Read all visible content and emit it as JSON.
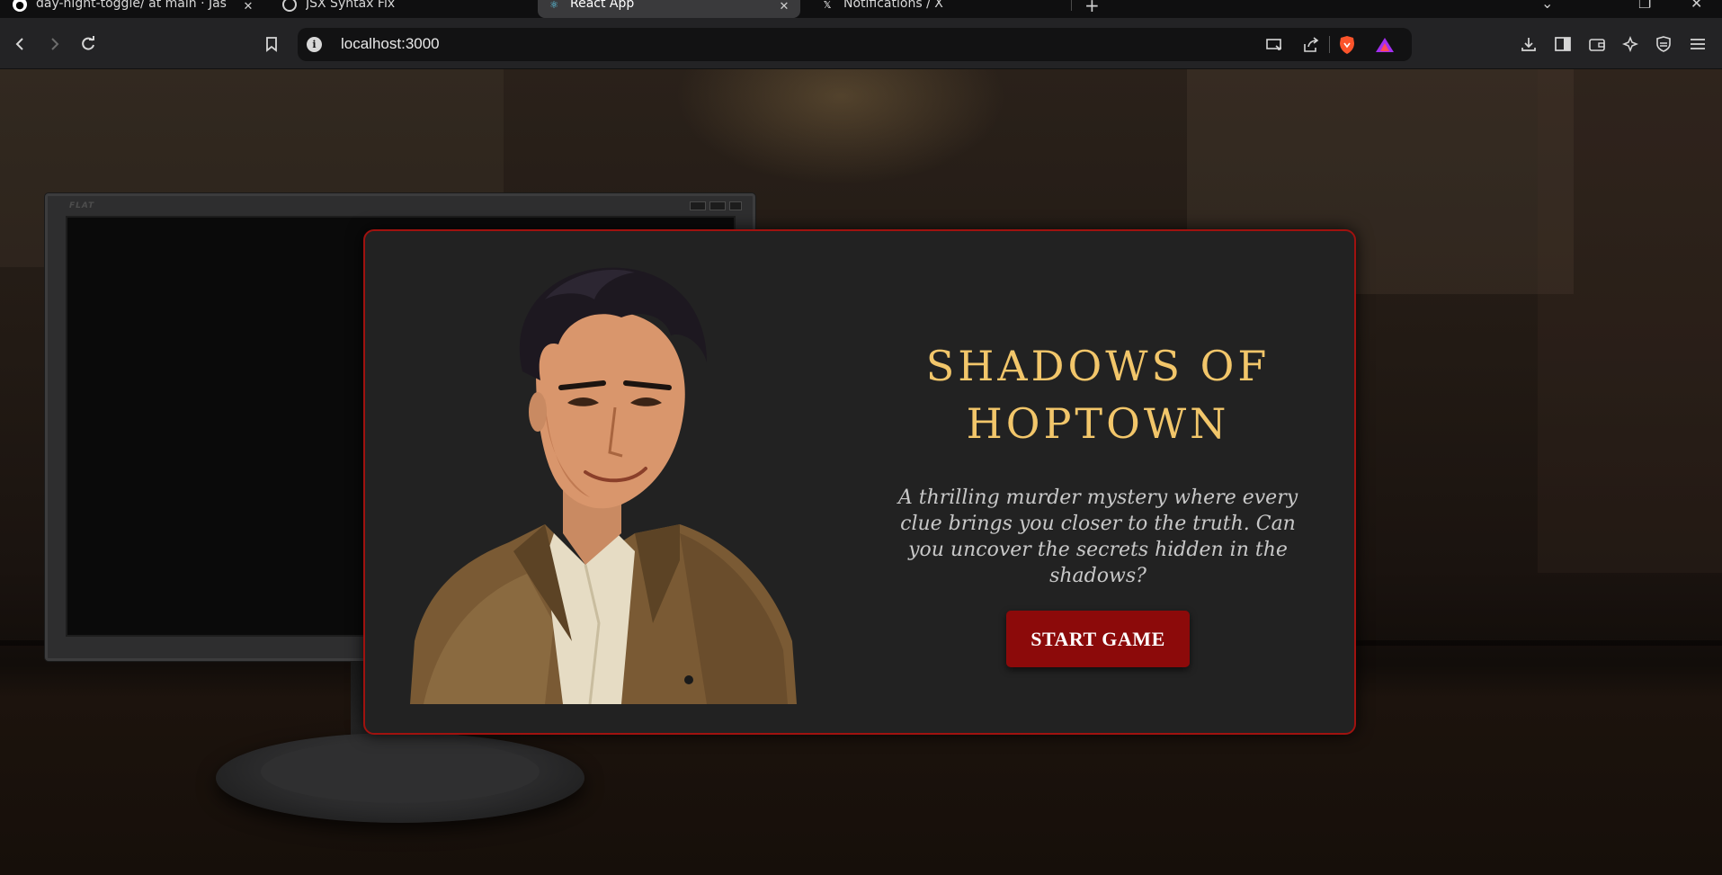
{
  "browser": {
    "tabs": [
      {
        "label": "day-night-toggle/ at main · Jas",
        "favicon": "github-icon",
        "active": false
      },
      {
        "label": "JSX Syntax Fix",
        "favicon": "chatgpt-icon",
        "active": false
      },
      {
        "label": "React App",
        "favicon": "react-icon",
        "active": true
      },
      {
        "label": "Notifications / X",
        "favicon": "x-icon",
        "active": false
      }
    ],
    "address": "localhost:3000",
    "toolbar_icons": [
      "back-icon",
      "forward-icon",
      "reload-icon",
      "bookmark-icon",
      "cast-icon",
      "share-icon",
      "brave-shield-icon",
      "brave-rewards-icon",
      "download-icon",
      "sidebar-icon",
      "wallet-icon",
      "leo-ai-icon",
      "vpn-icon",
      "menu-icon"
    ]
  },
  "monitor": {
    "brand": "FLAT"
  },
  "game": {
    "title": "SHADOWS OF HOPTOWN",
    "description": "A thrilling murder mystery where every clue brings you closer to the truth. Can you uncover the secrets hidden in the shadows?",
    "start_label": "START GAME"
  },
  "colors": {
    "title": "#f2c66a",
    "button": "#8c0a0a",
    "card_border": "#a0120f",
    "card_bg": "#222222"
  }
}
